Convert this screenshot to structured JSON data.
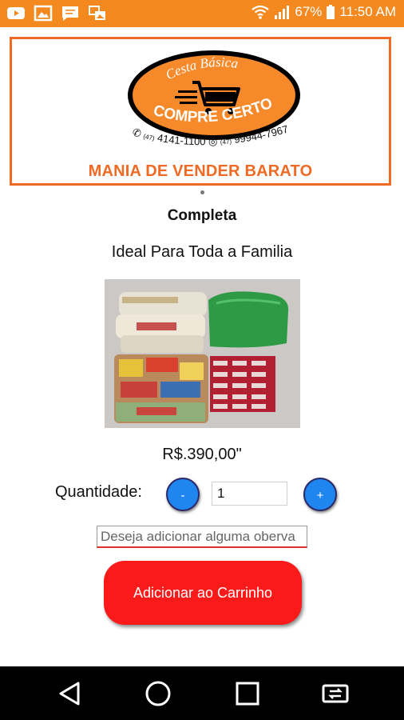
{
  "status_bar": {
    "battery": "67%",
    "time": "11:50 AM",
    "background": "#f48a1f"
  },
  "header": {
    "logo": {
      "line1": "Cesta Básica",
      "line2": "COMPRE CERTO",
      "phone1_prefix": "(47)",
      "phone1": "4141-1100",
      "phone2_prefix": "(47)",
      "phone2": "99944-7967"
    },
    "tagline": "MANIA DE VENDER BARATO",
    "accent": "#ef6a24"
  },
  "product": {
    "title": "Completa",
    "subtitle": "Ideal Para Toda a Familia",
    "price": "R$.390,00\""
  },
  "quantity": {
    "label": "Quantidade:",
    "minus_label": "-",
    "plus_label": "+",
    "value": "1"
  },
  "observation": {
    "placeholder": "Deseja adicionar alguma oberva"
  },
  "cart_button": {
    "label": "Adicionar ao Carrinho",
    "color": "#fb1a1a"
  },
  "nav_bar": {
    "icons": [
      "back-icon",
      "home-icon",
      "recents-icon",
      "switch-icon"
    ]
  }
}
